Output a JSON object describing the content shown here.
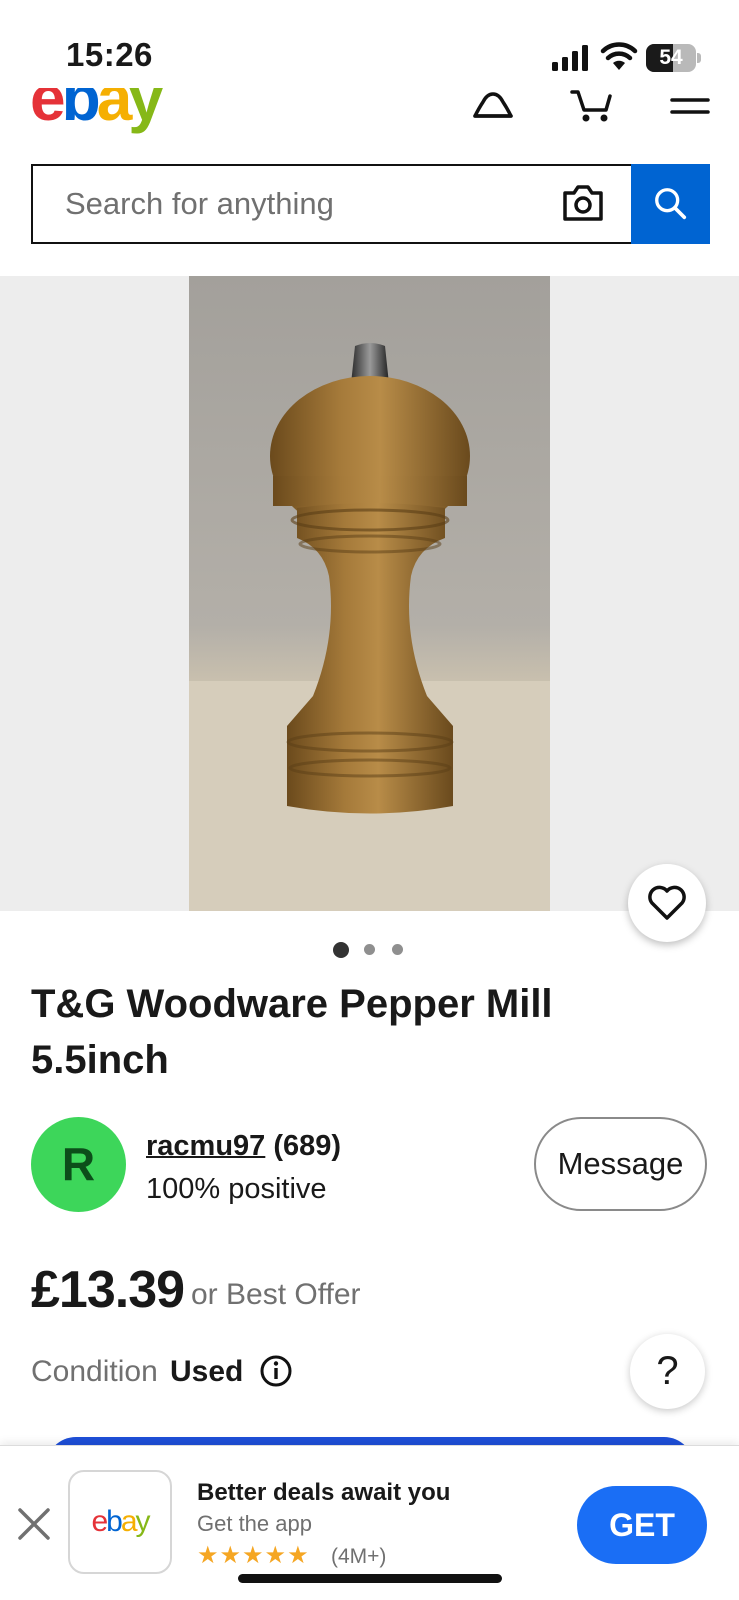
{
  "status_bar": {
    "time": "15:26",
    "battery": "54",
    "battery_level": 0.54
  },
  "header": {
    "logo": {
      "l1": "e",
      "l2": "b",
      "l3": "a",
      "l4": "y"
    },
    "icons": [
      "notifications-icon",
      "cart-icon",
      "menu-icon"
    ]
  },
  "search": {
    "placeholder": "Search for anything",
    "camera_icon": "camera-icon",
    "search_icon": "search-icon"
  },
  "gallery": {
    "image_count": 3,
    "active_index": 0,
    "favorite_icon": "heart-icon"
  },
  "listing": {
    "title": "T&G Woodware Pepper Mill 5.5inch",
    "price": "£13.39",
    "offer_text": "or Best Offer",
    "condition_label": "Condition",
    "condition_value": "Used"
  },
  "seller": {
    "initial": "R",
    "name": "racmu97",
    "feedback": "(689)",
    "positive": "100% positive",
    "message_label": "Message"
  },
  "help": {
    "label": "?"
  },
  "app_banner": {
    "logo": {
      "l1": "e",
      "l2": "b",
      "l3": "a",
      "l4": "y"
    },
    "title": "Better deals await you",
    "subtitle": "Get the app",
    "stars": "★★★★★",
    "rating_count": "(4M+)",
    "get_label": "GET"
  },
  "colors": {
    "primary_blue": "#0064d2",
    "get_button": "#1a6ef5",
    "avatar_green": "#3dd65a",
    "star": "#f5a623",
    "muted_text": "#707070"
  }
}
